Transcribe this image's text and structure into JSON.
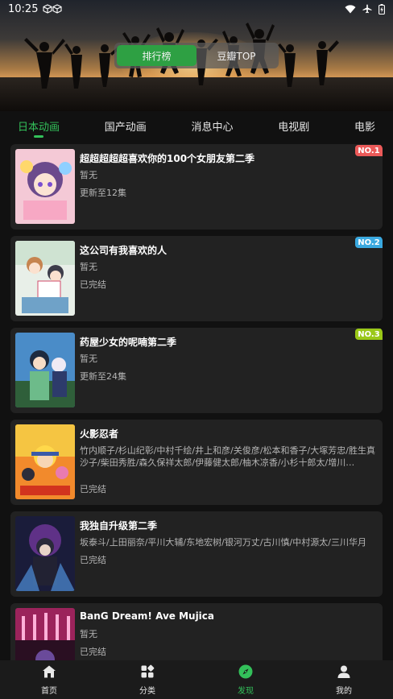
{
  "status": {
    "time": "10:25"
  },
  "segment": {
    "options": [
      "排行榜",
      "豆瓣TOP"
    ],
    "active": 0
  },
  "categories": [
    "日本动画",
    "国产动画",
    "消息中心",
    "电视剧",
    "电影"
  ],
  "colors": {
    "accent": "#33c05a",
    "rank1": "#ec5a59",
    "rank2": "#3aa9e0",
    "rank3": "#9ac818"
  },
  "items": [
    {
      "title": "超超超超超喜欢你的100个女朋友第二季",
      "sub": "暂无",
      "status": "更新至12集",
      "rank": "NO.1"
    },
    {
      "title": "这公司有我喜欢的人",
      "sub": "暂无",
      "status": "已完结",
      "rank": "NO.2"
    },
    {
      "title": "药屋少女的呢喃第二季",
      "sub": "暂无",
      "status": "更新至24集",
      "rank": "NO.3"
    },
    {
      "title": "火影忍者",
      "sub": "竹内顺子/杉山纪彰/中村千绘/井上和彦/关俊彦/松本和香子/大塚芳忠/胜生真沙子/柴田秀胜/森久保祥太郎/伊藤健太郎/柚木凉香/小杉十郎太/增川…",
      "status": "已完结"
    },
    {
      "title": "我独自升级第二季",
      "sub": "坂泰斗/上田丽奈/平川大辅/东地宏树/银河万丈/古川慎/中村源太/三川华月",
      "status": "已完结"
    },
    {
      "title": "BanG Dream! Ave Mujica",
      "sub": "暂无",
      "status": "已完结"
    }
  ],
  "nav": [
    {
      "label": "首页",
      "icon": "home-icon"
    },
    {
      "label": "分类",
      "icon": "category-icon"
    },
    {
      "label": "发现",
      "icon": "compass-icon"
    },
    {
      "label": "我的",
      "icon": "user-icon"
    }
  ],
  "nav_active": 2
}
